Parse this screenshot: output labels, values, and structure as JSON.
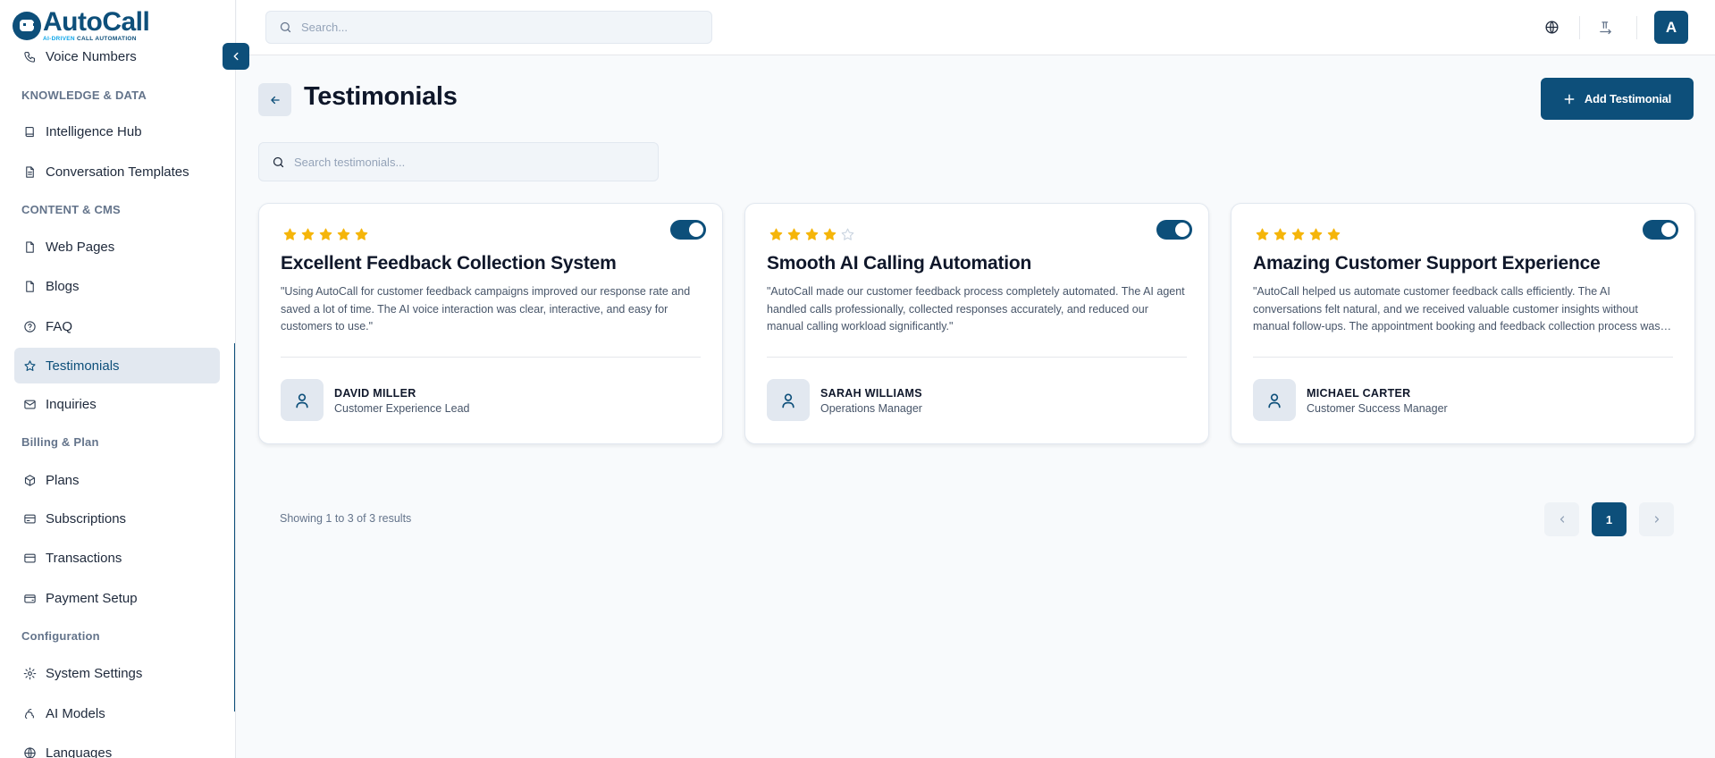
{
  "brand": {
    "name_part1": "Auto",
    "name_part2": "Call",
    "tagline_part1": "AI-DRIVEN",
    "tagline_part2": "CALL AUTOMATION"
  },
  "sidebar": {
    "items": [
      {
        "label": "Voice Numbers",
        "icon": "phone-icon"
      },
      {
        "section": "KNOWLEDGE & DATA"
      },
      {
        "label": "Intelligence Hub",
        "icon": "book-icon"
      },
      {
        "label": "Conversation Templates",
        "icon": "file-text-icon"
      },
      {
        "section": "CONTENT & CMS"
      },
      {
        "label": "Web Pages",
        "icon": "file-icon"
      },
      {
        "label": "Blogs",
        "icon": "file-icon"
      },
      {
        "label": "FAQ",
        "icon": "help-circle-icon"
      },
      {
        "label": "Testimonials",
        "icon": "star-icon",
        "active": true
      },
      {
        "label": "Inquiries",
        "icon": "mail-icon"
      },
      {
        "section": "Billing & Plan"
      },
      {
        "label": "Plans",
        "icon": "package-icon"
      },
      {
        "label": "Subscriptions",
        "icon": "receipt-icon"
      },
      {
        "label": "Transactions",
        "icon": "credit-card-icon"
      },
      {
        "label": "Payment Setup",
        "icon": "wallet-icon"
      },
      {
        "section": "Configuration"
      },
      {
        "label": "System Settings",
        "icon": "settings-icon"
      },
      {
        "label": "AI Models",
        "icon": "cpu-icon"
      },
      {
        "label": "Languages",
        "icon": "globe-icon"
      }
    ]
  },
  "topbar": {
    "search_placeholder": "Search...",
    "avatar_initial": "A"
  },
  "page": {
    "title": "Testimonials",
    "add_button_label": "Add Testimonial",
    "search_placeholder": "Search testimonials..."
  },
  "testimonials": [
    {
      "rating": 5,
      "enabled": true,
      "title": "Excellent Feedback Collection System",
      "text": "\"Using AutoCall for customer feedback campaigns improved our response rate and saved a lot of time. The AI voice interaction was clear, interactive, and easy for customers to use.\"",
      "author": "DAVID MILLER",
      "role": "Customer Experience Lead"
    },
    {
      "rating": 4,
      "enabled": true,
      "title": "Smooth AI Calling Automation",
      "text": "\"AutoCall made our customer feedback process completely automated. The AI agent handled calls professionally, collected responses accurately, and reduced our manual calling workload significantly.\"",
      "author": "SARAH WILLIAMS",
      "role": "Operations Manager"
    },
    {
      "rating": 5,
      "enabled": true,
      "title": "Amazing Customer Support Experience",
      "text": "\"AutoCall helped us automate customer feedback calls efficiently. The AI conversations felt natural, and we received valuable customer insights without manual follow-ups. The appointment booking and feedback collection process was smooth.\"",
      "author": "MICHAEL CARTER",
      "role": "Customer Success Manager"
    }
  ],
  "pagination": {
    "summary": "Showing 1 to 3 of 3 results",
    "current_page": "1"
  },
  "colors": {
    "primary": "#0d4f7a",
    "star": "#f5b50a",
    "star_empty": "#cbd5e1"
  }
}
